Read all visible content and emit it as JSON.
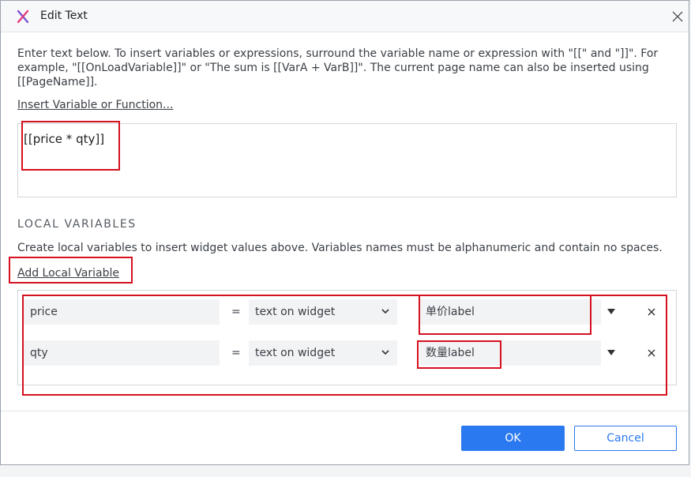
{
  "window": {
    "title": "Edit Text",
    "close_icon": "close-icon",
    "logo_icon": "app-logo-icon"
  },
  "description": "Enter text below. To insert variables or expressions, surround the variable name or expression with \"[[\" and \"]]\". For example, \"[[OnLoadVariable]]\" or \"The sum is [[VarA + VarB]]\". The current page name can also be inserted using [[PageName]].",
  "insert_link": "Insert Variable or Function...",
  "text_value": "[[price * qty]]",
  "local_vars": {
    "heading": "LOCAL VARIABLES",
    "hint": "Create local variables to insert widget values above. Variables names must be alphanumeric and contain no spaces.",
    "add_link": "Add Local Variable",
    "rows": [
      {
        "name": "price",
        "equals": "=",
        "type": "text on widget",
        "widget": "单价label"
      },
      {
        "name": "qty",
        "equals": "=",
        "type": "text on widget",
        "widget": "数量label"
      }
    ]
  },
  "buttons": {
    "ok": "OK",
    "cancel": "Cancel"
  },
  "colors": {
    "accent": "#2b79f0",
    "highlight": "#d5101f"
  }
}
